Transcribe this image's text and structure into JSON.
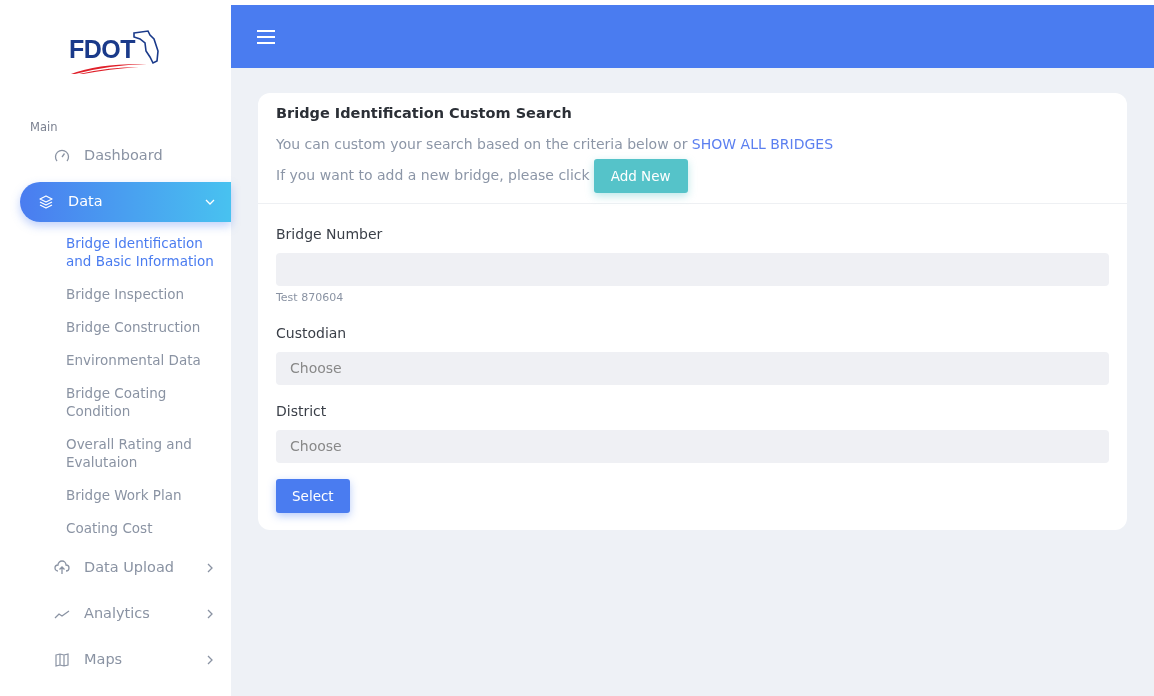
{
  "logo": {
    "text": "FDOT"
  },
  "sidebar": {
    "section_label": "Main",
    "items": [
      {
        "label": "Dashboard",
        "selected": false
      },
      {
        "label": "Data",
        "selected": true,
        "expanded": true,
        "children": [
          {
            "label": "Bridge Identification and Basic Information",
            "selected": true
          },
          {
            "label": "Bridge Inspection",
            "selected": false
          },
          {
            "label": "Bridge Construction",
            "selected": false
          },
          {
            "label": "Environmental Data",
            "selected": false
          },
          {
            "label": "Bridge Coating Condition",
            "selected": false
          },
          {
            "label": "Overall Rating and Evalutaion",
            "selected": false
          },
          {
            "label": "Bridge Work Plan",
            "selected": false
          },
          {
            "label": "Coating Cost",
            "selected": false
          }
        ]
      },
      {
        "label": "Data Upload",
        "selected": false,
        "expanded": false
      },
      {
        "label": "Analytics",
        "selected": false,
        "expanded": false
      },
      {
        "label": "Maps",
        "selected": false,
        "expanded": false
      }
    ]
  },
  "card": {
    "title": "Bridge Identification Custom Search",
    "intro": "You can custom your search based on the criteria below or",
    "show_all_link": "SHOW ALL BRIDGES",
    "add_text": "If you want to add a new bridge, please click",
    "add_button": "Add New",
    "fields": [
      {
        "kind": "input",
        "label": "Bridge Number",
        "help": "Test 870604"
      },
      {
        "kind": "select",
        "label": "Custodian",
        "value": "Choose"
      },
      {
        "kind": "select",
        "label": "District",
        "value": "Choose"
      }
    ],
    "submit_button": "Select"
  }
}
